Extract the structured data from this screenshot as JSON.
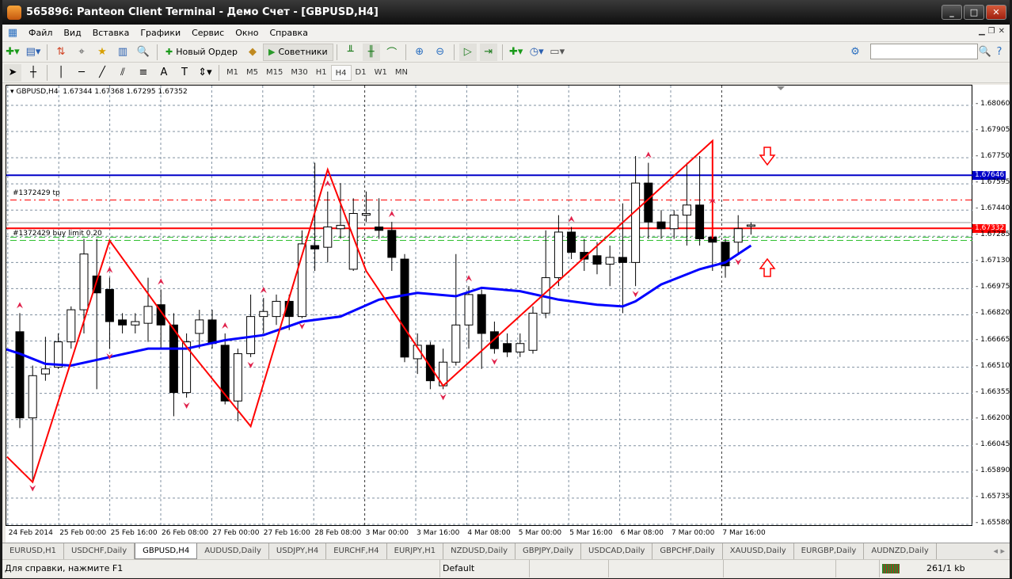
{
  "window": {
    "title": "565896: Panteon Client Terminal - Демо Счет - [GBPUSD,H4]"
  },
  "menu": [
    "Файл",
    "Вид",
    "Вставка",
    "Графики",
    "Сервис",
    "Окно",
    "Справка"
  ],
  "toolbar": {
    "new_order": "Новый Ордер",
    "experts": "Советники"
  },
  "timeframes": [
    "M1",
    "M5",
    "M15",
    "M30",
    "H1",
    "H4",
    "D1",
    "W1",
    "MN"
  ],
  "selected_timeframe": "H4",
  "chart": {
    "header": "GBPUSD,H4  1.67344 1.67368 1.67295 1.67352",
    "tp_label": "#1372429 tp",
    "buy_limit_label": "#1372429 buy limit 0.20",
    "blue_line_price": "1.67646",
    "bid_price": "1.67332",
    "tp_price": 1.675,
    "buy_limit_price": 1.6727,
    "colors": {
      "bull": "#ffffff",
      "bear": "#000000",
      "ma": "#0000ff",
      "zigzag": "#ff0000",
      "level": "#0000c8",
      "bid": "#ff0000",
      "grid": "#8090a0",
      "fractal": "#e0204a",
      "limit": "#30c030"
    }
  },
  "chart_data": {
    "type": "candlestick",
    "symbol": "GBPUSD",
    "timeframe": "H4",
    "ylim": [
      1.6558,
      1.6811
    ],
    "price_ticks": [
      "1.68060",
      "1.67905",
      "1.67750",
      "1.67595",
      "1.67440",
      "1.67285",
      "1.67130",
      "1.66975",
      "1.66820",
      "1.66665",
      "1.66510",
      "1.66355",
      "1.66200",
      "1.66045",
      "1.65890",
      "1.65735",
      "1.65580"
    ],
    "time_ticks": [
      "24 Feb 2014",
      "25 Feb 00:00",
      "25 Feb 16:00",
      "26 Feb 08:00",
      "27 Feb 00:00",
      "27 Feb 16:00",
      "28 Feb 08:00",
      "3 Mar 00:00",
      "3 Mar 16:00",
      "4 Mar 08:00",
      "5 Mar 00:00",
      "5 Mar 16:00",
      "6 Mar 08:00",
      "7 Mar 00:00",
      "7 Mar 16:00"
    ],
    "candles": [
      [
        1.6672,
        1.6683,
        1.6615,
        1.6621
      ],
      [
        1.6621,
        1.6652,
        1.6584,
        1.6646
      ],
      [
        1.6647,
        1.6669,
        1.6643,
        1.665
      ],
      [
        1.6651,
        1.6671,
        1.665,
        1.6666
      ],
      [
        1.6666,
        1.6687,
        1.6662,
        1.6685
      ],
      [
        1.6685,
        1.6727,
        1.6671,
        1.6718
      ],
      [
        1.6705,
        1.6727,
        1.6638,
        1.6695
      ],
      [
        1.6697,
        1.6704,
        1.6662,
        1.6678
      ],
      [
        1.6679,
        1.6683,
        1.6671,
        1.6676
      ],
      [
        1.6676,
        1.6683,
        1.6671,
        1.6678
      ],
      [
        1.6677,
        1.6704,
        1.6666,
        1.6687
      ],
      [
        1.6688,
        1.6697,
        1.6662,
        1.6676
      ],
      [
        1.6676,
        1.6683,
        1.6622,
        1.6636
      ],
      [
        1.6636,
        1.6671,
        1.6633,
        1.6666
      ],
      [
        1.6671,
        1.6685,
        1.6662,
        1.6679
      ],
      [
        1.6679,
        1.6685,
        1.6662,
        1.6665
      ],
      [
        1.6664,
        1.6671,
        1.6629,
        1.6631
      ],
      [
        1.6631,
        1.6662,
        1.6619,
        1.6659
      ],
      [
        1.6659,
        1.6694,
        1.6657,
        1.6681
      ],
      [
        1.6681,
        1.6692,
        1.6671,
        1.6684
      ],
      [
        1.6681,
        1.6694,
        1.6676,
        1.669
      ],
      [
        1.669,
        1.6694,
        1.6673,
        1.6681
      ],
      [
        1.6681,
        1.6732,
        1.668,
        1.6724
      ],
      [
        1.6723,
        1.6772,
        1.6708,
        1.6721
      ],
      [
        1.6722,
        1.6755,
        1.6713,
        1.6734
      ],
      [
        1.6733,
        1.676,
        1.6727,
        1.6735
      ],
      [
        1.6709,
        1.6751,
        1.6708,
        1.6742
      ],
      [
        1.6741,
        1.6755,
        1.6737,
        1.6742
      ],
      [
        1.6734,
        1.6751,
        1.6727,
        1.6732
      ],
      [
        1.6732,
        1.6737,
        1.6708,
        1.6716
      ],
      [
        1.6715,
        1.6718,
        1.6654,
        1.6657
      ],
      [
        1.6656,
        1.6671,
        1.6647,
        1.6664
      ],
      [
        1.6664,
        1.6666,
        1.6638,
        1.6643
      ],
      [
        1.664,
        1.6662,
        1.6638,
        1.6654
      ],
      [
        1.6654,
        1.6718,
        1.6652,
        1.6676
      ],
      [
        1.6676,
        1.6699,
        1.6662,
        1.6694
      ],
      [
        1.6694,
        1.6697,
        1.665,
        1.6671
      ],
      [
        1.6672,
        1.6678,
        1.6659,
        1.6662
      ],
      [
        1.6665,
        1.6671,
        1.6657,
        1.666
      ],
      [
        1.666,
        1.6671,
        1.6657,
        1.6665
      ],
      [
        1.6661,
        1.6687,
        1.6659,
        1.6683
      ],
      [
        1.6683,
        1.6732,
        1.668,
        1.6704
      ],
      [
        1.6704,
        1.6741,
        1.6699,
        1.6731
      ],
      [
        1.6731,
        1.6734,
        1.6715,
        1.6719
      ],
      [
        1.6719,
        1.6727,
        1.6708,
        1.6715
      ],
      [
        1.6717,
        1.6725,
        1.6706,
        1.6712
      ],
      [
        1.6712,
        1.6723,
        1.6699,
        1.6716
      ],
      [
        1.6716,
        1.6748,
        1.6683,
        1.6713
      ],
      [
        1.6713,
        1.6776,
        1.6699,
        1.676
      ],
      [
        1.676,
        1.6772,
        1.6727,
        1.6737
      ],
      [
        1.6737,
        1.6744,
        1.6727,
        1.6733
      ],
      [
        1.6733,
        1.6744,
        1.6727,
        1.6741
      ],
      [
        1.6741,
        1.6772,
        1.6723,
        1.6747
      ],
      [
        1.6747,
        1.6776,
        1.6723,
        1.6727
      ],
      [
        1.6728,
        1.6745,
        1.6708,
        1.6725
      ],
      [
        1.6725,
        1.6727,
        1.6704,
        1.6711
      ],
      [
        1.6725,
        1.6741,
        1.6718,
        1.6733
      ],
      [
        1.67344,
        1.67368,
        1.67295,
        1.67352
      ]
    ],
    "ma": [
      [
        0,
        1.6659
      ],
      [
        2,
        1.6653
      ],
      [
        4,
        1.6652
      ],
      [
        7,
        1.6657
      ],
      [
        10,
        1.6662
      ],
      [
        13,
        1.6662
      ],
      [
        16,
        1.6667
      ],
      [
        19,
        1.667
      ],
      [
        22,
        1.6678
      ],
      [
        25,
        1.6681
      ],
      [
        28,
        1.6691
      ],
      [
        31,
        1.6695
      ],
      [
        34,
        1.6693
      ],
      [
        36,
        1.6698
      ],
      [
        39,
        1.6696
      ],
      [
        42,
        1.6691
      ],
      [
        45,
        1.6688
      ],
      [
        47,
        1.6687
      ],
      [
        48,
        1.669
      ],
      [
        50,
        1.67
      ],
      [
        53,
        1.6709
      ],
      [
        55,
        1.6713
      ],
      [
        57,
        1.6723
      ]
    ],
    "zigzag": [
      [
        -1,
        1.6598
      ],
      [
        1,
        1.6583
      ],
      [
        7,
        1.6726
      ],
      [
        13,
        1.6663
      ],
      [
        18,
        1.6616
      ],
      [
        24,
        1.6768
      ],
      [
        27,
        1.6708
      ],
      [
        33,
        1.664
      ],
      [
        54,
        1.6785
      ],
      [
        54,
        1.6727
      ]
    ],
    "fractals_up": [
      0,
      7,
      11,
      16,
      19,
      24,
      29,
      35,
      43,
      49,
      54
    ],
    "fractals_down": [
      1,
      7,
      13,
      18,
      22,
      33,
      37,
      48,
      56
    ]
  },
  "tabs": [
    "EURUSD,H1",
    "USDCHF,Daily",
    "GBPUSD,H4",
    "AUDUSD,Daily",
    "USDJPY,H4",
    "EURCHF,H4",
    "EURJPY,H1",
    "NZDUSD,Daily",
    "GBPJPY,Daily",
    "USDCAD,Daily",
    "GBPCHF,Daily",
    "XAUUSD,Daily",
    "EURGBP,Daily",
    "AUDNZD,Daily"
  ],
  "active_tab": "GBPUSD,H4",
  "status": {
    "help": "Для справки, нажмите F1",
    "profile": "Default",
    "traffic": "261/1 kb"
  }
}
